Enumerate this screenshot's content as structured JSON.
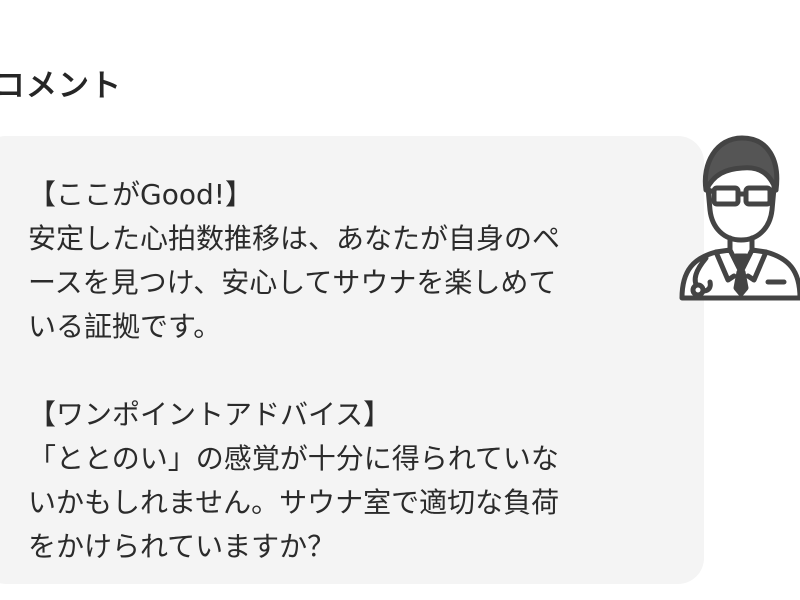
{
  "section": {
    "title": "コメント"
  },
  "comment": {
    "good_heading": "【ここがGood!】",
    "good_lines": [
      "安定した心拍数推移は、あなたが自身のペ",
      "ースを見つけ、安心してサウナを楽しめて",
      "いる証拠です。"
    ],
    "advice_heading": "【ワンポイントアドバイス】",
    "advice_lines": [
      "「ととのい」の感覚が十分に得られていな",
      "いかもしれません。サウナ室で適切な負荷",
      "をかけられていますか？"
    ]
  },
  "icons": {
    "advisor_avatar": "doctor-avatar-icon"
  },
  "colors": {
    "bubble_background": "#f4f4f4",
    "text": "#2b2b2b",
    "icon_stroke": "#444444"
  }
}
